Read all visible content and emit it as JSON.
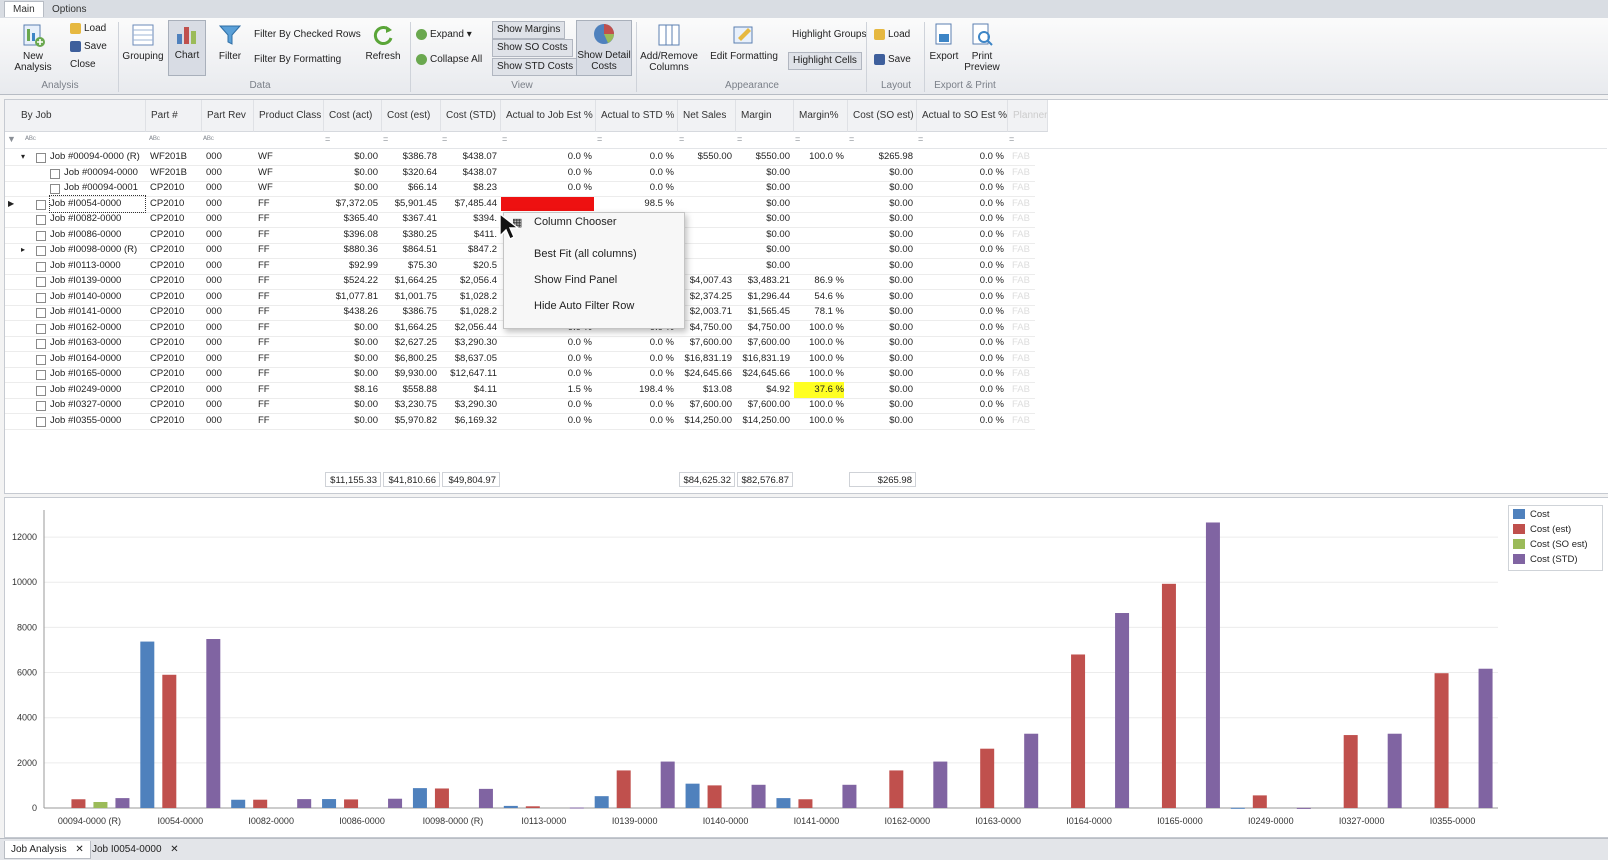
{
  "ribbon": {
    "tabs": [
      "Main",
      "Options"
    ],
    "buttons": {
      "new_analysis": "New Analysis",
      "load": "Load",
      "save": "Save",
      "close": "Close",
      "grouping": "Grouping",
      "chart": "Chart",
      "filter": "Filter",
      "filter_checked": "Filter By Checked Rows",
      "filter_formatting": "Filter By Formatting",
      "refresh": "Refresh",
      "expand": "Expand",
      "collapse_all": "Collapse All",
      "show_margins": "Show Margins",
      "show_so_costs": "Show SO Costs",
      "show_std_costs": "Show STD Costs",
      "show_detail_costs": "Show Detail Costs",
      "add_remove_columns": "Add/Remove Columns",
      "edit_formatting": "Edit Formatting",
      "highlight_groups": "Highlight Groups",
      "highlight_cells": "Highlight Cells",
      "layout_load": "Load",
      "layout_save": "Save",
      "export": "Export",
      "print_preview": "Print Preview"
    },
    "groups": [
      "Analysis",
      "Data",
      "View",
      "Appearance",
      "Layout",
      "Export & Print"
    ]
  },
  "grid": {
    "group_col": "By Job",
    "columns": [
      "Part #",
      "Part Rev",
      "Product Class",
      "Cost (act)",
      "Cost (est)",
      "Cost (STD)",
      "Actual to Job Est %",
      "Actual to STD %",
      "Net Sales",
      "Margin",
      "Margin%",
      "Cost (SO est)",
      "Actual to SO Est %",
      "Planner"
    ],
    "rows": [
      {
        "job": "Job #00094-0000 (R)",
        "part": "WF201B",
        "rev": "000",
        "cls": "WF",
        "act": "$0.00",
        "est": "$386.78",
        "std": "$438.07",
        "aje": "0.0 %",
        "astd": "0.0 %",
        "net": "$550.00",
        "margin": "$550.00",
        "mpct": "100.0 %",
        "soest": "$265.98",
        "aso": "0.0 %",
        "planner": "FAB"
      },
      {
        "job": "Job #00094-0000",
        "part": "WF201B",
        "rev": "000",
        "cls": "WF",
        "act": "$0.00",
        "est": "$320.64",
        "std": "$438.07",
        "aje": "0.0 %",
        "astd": "0.0 %",
        "net": "",
        "margin": "$0.00",
        "mpct": "",
        "soest": "$0.00",
        "aso": "0.0 %",
        "planner": "FAB"
      },
      {
        "job": "Job #00094-0001",
        "part": "CP2010",
        "rev": "000",
        "cls": "WF",
        "act": "$0.00",
        "est": "$66.14",
        "std": "$8.23",
        "aje": "0.0 %",
        "astd": "0.0 %",
        "net": "",
        "margin": "$0.00",
        "mpct": "",
        "soest": "$0.00",
        "aso": "0.0 %",
        "planner": "FAB"
      },
      {
        "job": "Job #I0054-0000",
        "part": "CP2010",
        "rev": "000",
        "cls": "FF",
        "act": "$7,372.05",
        "est": "$5,901.45",
        "std": "$7,485.44",
        "aje": "",
        "astd": "98.5 %",
        "net": "",
        "margin": "$0.00",
        "mpct": "",
        "soest": "$0.00",
        "aso": "0.0 %",
        "planner": "FAB"
      },
      {
        "job": "Job #I0082-0000",
        "part": "CP2010",
        "rev": "000",
        "cls": "FF",
        "act": "$365.40",
        "est": "$367.41",
        "std": "$394.",
        "aje": "",
        "astd": "",
        "net": "",
        "margin": "$0.00",
        "mpct": "",
        "soest": "$0.00",
        "aso": "0.0 %",
        "planner": "FAB"
      },
      {
        "job": "Job #I0086-0000",
        "part": "CP2010",
        "rev": "000",
        "cls": "FF",
        "act": "$396.08",
        "est": "$380.25",
        "std": "$411.",
        "aje": "",
        "astd": "",
        "net": "",
        "margin": "$0.00",
        "mpct": "",
        "soest": "$0.00",
        "aso": "0.0 %",
        "planner": "FAB"
      },
      {
        "job": "Job #I0098-0000 (R)",
        "part": "CP2010",
        "rev": "000",
        "cls": "FF",
        "act": "$880.36",
        "est": "$864.51",
        "std": "$847.2",
        "aje": "",
        "astd": "",
        "net": "",
        "margin": "$0.00",
        "mpct": "",
        "soest": "$0.00",
        "aso": "0.0 %",
        "planner": "FAB"
      },
      {
        "job": "Job #I0113-0000",
        "part": "CP2010",
        "rev": "000",
        "cls": "FF",
        "act": "$92.99",
        "est": "$75.30",
        "std": "$20.5",
        "aje": "",
        "astd": "",
        "net": "",
        "margin": "$0.00",
        "mpct": "",
        "soest": "$0.00",
        "aso": "0.0 %",
        "planner": "FAB"
      },
      {
        "job": "Job #I0139-0000",
        "part": "CP2010",
        "rev": "000",
        "cls": "FF",
        "act": "$524.22",
        "est": "$1,664.25",
        "std": "$2,056.4",
        "aje": "",
        "astd": "",
        "net": "$4,007.43",
        "margin": "$3,483.21",
        "mpct": "86.9 %",
        "soest": "$0.00",
        "aso": "0.0 %",
        "planner": "FAB"
      },
      {
        "job": "Job #I0140-0000",
        "part": "CP2010",
        "rev": "000",
        "cls": "FF",
        "act": "$1,077.81",
        "est": "$1,001.75",
        "std": "$1,028.2",
        "aje": "",
        "astd": "",
        "net": "$2,374.25",
        "margin": "$1,296.44",
        "mpct": "54.6 %",
        "soest": "$0.00",
        "aso": "0.0 %",
        "planner": "FAB"
      },
      {
        "job": "Job #I0141-0000",
        "part": "CP2010",
        "rev": "000",
        "cls": "FF",
        "act": "$438.26",
        "est": "$386.75",
        "std": "$1,028.2",
        "aje": "",
        "astd": "",
        "net": "$2,003.71",
        "margin": "$1,565.45",
        "mpct": "78.1 %",
        "soest": "$0.00",
        "aso": "0.0 %",
        "planner": "FAB"
      },
      {
        "job": "Job #I0162-0000",
        "part": "CP2010",
        "rev": "000",
        "cls": "FF",
        "act": "$0.00",
        "est": "$1,664.25",
        "std": "$2,056.44",
        "aje": "0.0 %",
        "astd": "0.0 %",
        "net": "$4,750.00",
        "margin": "$4,750.00",
        "mpct": "100.0 %",
        "soest": "$0.00",
        "aso": "0.0 %",
        "planner": "FAB"
      },
      {
        "job": "Job #I0163-0000",
        "part": "CP2010",
        "rev": "000",
        "cls": "FF",
        "act": "$0.00",
        "est": "$2,627.25",
        "std": "$3,290.30",
        "aje": "0.0 %",
        "astd": "0.0 %",
        "net": "$7,600.00",
        "margin": "$7,600.00",
        "mpct": "100.0 %",
        "soest": "$0.00",
        "aso": "0.0 %",
        "planner": "FAB"
      },
      {
        "job": "Job #I0164-0000",
        "part": "CP2010",
        "rev": "000",
        "cls": "FF",
        "act": "$0.00",
        "est": "$6,800.25",
        "std": "$8,637.05",
        "aje": "0.0 %",
        "astd": "0.0 %",
        "net": "$16,831.19",
        "margin": "$16,831.19",
        "mpct": "100.0 %",
        "soest": "$0.00",
        "aso": "0.0 %",
        "planner": "FAB"
      },
      {
        "job": "Job #I0165-0000",
        "part": "CP2010",
        "rev": "000",
        "cls": "FF",
        "act": "$0.00",
        "est": "$9,930.00",
        "std": "$12,647.11",
        "aje": "0.0 %",
        "astd": "0.0 %",
        "net": "$24,645.66",
        "margin": "$24,645.66",
        "mpct": "100.0 %",
        "soest": "$0.00",
        "aso": "0.0 %",
        "planner": "FAB"
      },
      {
        "job": "Job #I0249-0000",
        "part": "CP2010",
        "rev": "000",
        "cls": "FF",
        "act": "$8.16",
        "est": "$558.88",
        "std": "$4.11",
        "aje": "1.5 %",
        "astd": "198.4 %",
        "net": "$13.08",
        "margin": "$4.92",
        "mpct": "37.6 %",
        "soest": "$0.00",
        "aso": "0.0 %",
        "planner": "FAB"
      },
      {
        "job": "Job #I0327-0000",
        "part": "CP2010",
        "rev": "000",
        "cls": "FF",
        "act": "$0.00",
        "est": "$3,230.75",
        "std": "$3,290.30",
        "aje": "0.0 %",
        "astd": "0.0 %",
        "net": "$7,600.00",
        "margin": "$7,600.00",
        "mpct": "100.0 %",
        "soest": "$0.00",
        "aso": "0.0 %",
        "planner": "FAB"
      },
      {
        "job": "Job #I0355-0000",
        "part": "CP2010",
        "rev": "000",
        "cls": "FF",
        "act": "$0.00",
        "est": "$5,970.82",
        "std": "$6,169.32",
        "aje": "0.0 %",
        "astd": "0.0 %",
        "net": "$14,250.00",
        "margin": "$14,250.00",
        "mpct": "100.0 %",
        "soest": "$0.00",
        "aso": "0.0 %",
        "planner": "FAB"
      }
    ],
    "totals": {
      "act": "$11,155.33",
      "est": "$41,810.66",
      "std": "$49,804.97",
      "net": "$84,625.32",
      "margin": "$82,576.87",
      "soest": "$265.98"
    },
    "highlight_colors": {
      "red": "#ee1111",
      "yellow": "#ffff22"
    }
  },
  "context_menu": {
    "items": [
      "Column Chooser",
      "Best Fit (all columns)",
      "Show Find Panel",
      "Hide Auto Filter Row"
    ]
  },
  "chart_data": {
    "type": "bar",
    "categories": [
      "00094-0000 (R)",
      "I0054-0000",
      "I0082-0000",
      "I0086-0000",
      "I0098-0000 (R)",
      "I0113-0000",
      "I0139-0000",
      "I0140-0000",
      "I0141-0000",
      "I0162-0000",
      "I0163-0000",
      "I0164-0000",
      "I0165-0000",
      "I0249-0000",
      "I0327-0000",
      "I0355-0000"
    ],
    "series": [
      {
        "name": "Cost",
        "color": "#4f81bd",
        "values": [
          0,
          7372.05,
          365.4,
          396.08,
          880.36,
          92.99,
          524.22,
          1077.81,
          438.26,
          0,
          0,
          0,
          0,
          8.16,
          0,
          0
        ]
      },
      {
        "name": "Cost (est)",
        "color": "#c0504d",
        "values": [
          386.78,
          5901.45,
          367.41,
          380.25,
          864.51,
          75.3,
          1664.25,
          1001.75,
          386.75,
          1664.25,
          2627.25,
          6800.25,
          9930.0,
          558.88,
          3230.75,
          5970.82
        ]
      },
      {
        "name": "Cost (SO est)",
        "color": "#9bbb59",
        "values": [
          265.98,
          0,
          0,
          0,
          0,
          0,
          0,
          0,
          0,
          0,
          0,
          0,
          0,
          0,
          0,
          0
        ]
      },
      {
        "name": "Cost (STD)",
        "color": "#8064a2",
        "values": [
          438.07,
          7485.44,
          394,
          411,
          847.2,
          20.5,
          2056.44,
          1028.2,
          1028.2,
          2056.44,
          3290.3,
          8637.05,
          12647.11,
          4.11,
          3290.3,
          6169.32
        ]
      }
    ],
    "yticks": [
      0,
      2000,
      4000,
      6000,
      8000,
      10000,
      12000
    ],
    "ylim": [
      0,
      13200
    ]
  },
  "bottom_tabs": [
    "Job Analysis",
    "Job I0054-0000"
  ]
}
